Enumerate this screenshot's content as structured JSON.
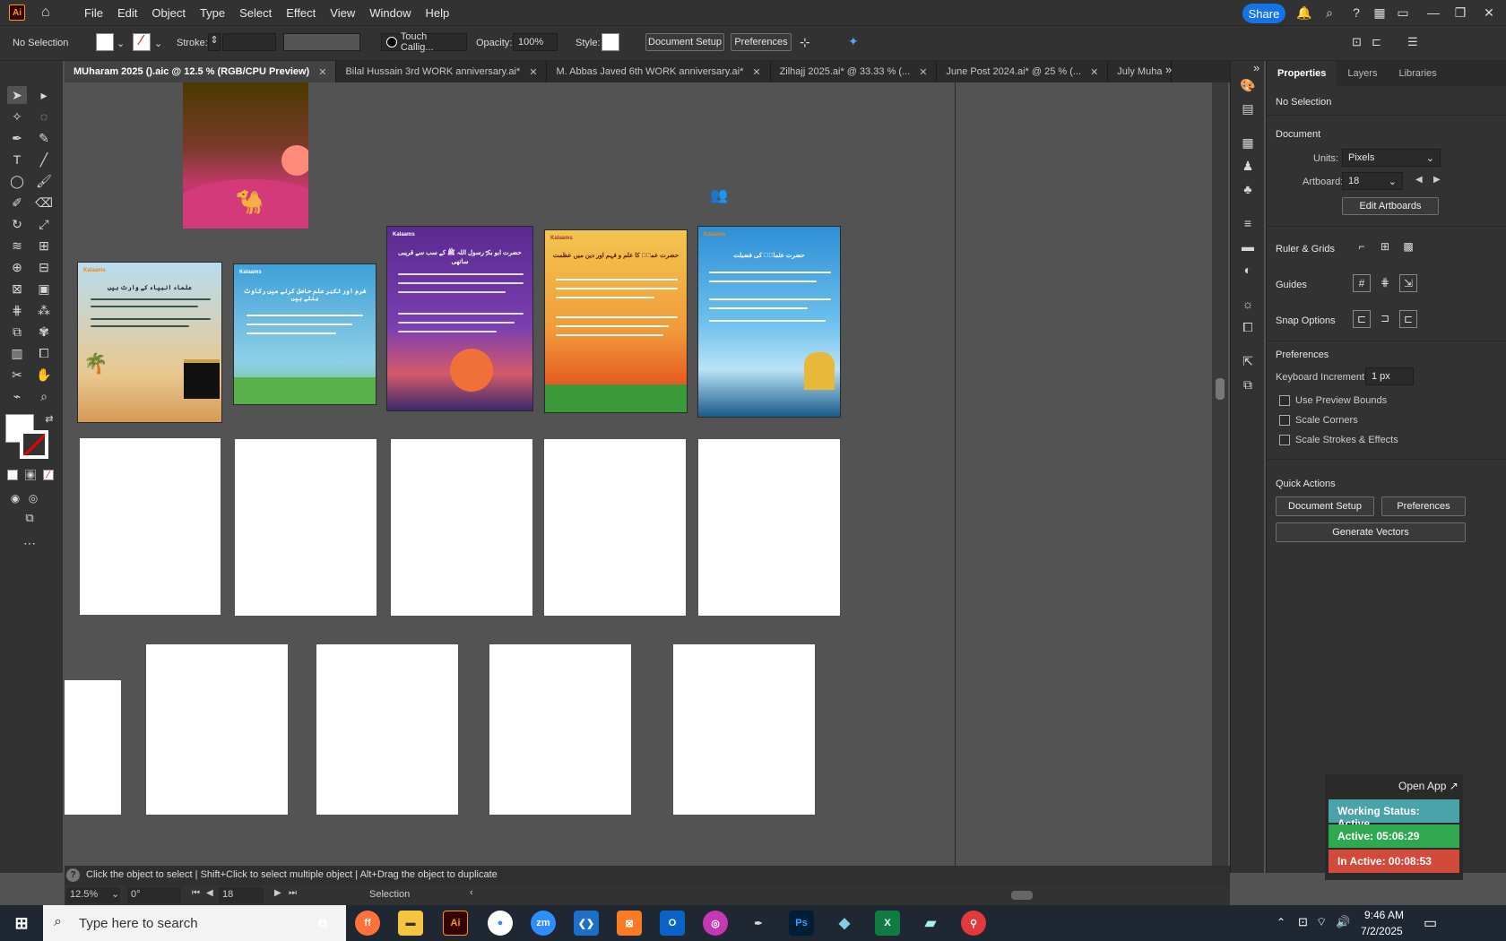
{
  "app": {
    "logo": "Ai",
    "menus": [
      "File",
      "Edit",
      "Object",
      "Type",
      "Select",
      "Effect",
      "View",
      "Window",
      "Help"
    ],
    "share": "Share"
  },
  "control": {
    "selection": "No Selection",
    "stroke_label": "Stroke:",
    "brush": "Touch Callig...",
    "opacity_label": "Opacity:",
    "opacity": "100%",
    "style_label": "Style:",
    "doc_setup": "Document Setup",
    "preferences": "Preferences"
  },
  "tabs": [
    {
      "label": "MUharam 2025 ().aic @ 12.5 % (RGB/CPU Preview)",
      "active": true
    },
    {
      "label": "Bilal Hussain  3rd  WORK anniversary.ai*"
    },
    {
      "label": "M. Abbas Javed  6th  WORK anniversary.ai*"
    },
    {
      "label": "Zilhajj 2025.ai* @ 33.33 % (..."
    },
    {
      "label": "June Post 2024.ai* @ 25 % (..."
    },
    {
      "label": "July Muha"
    }
  ],
  "posters": [
    {
      "brand": "Kalaams",
      "title": "علماء انبیاء کے وارث ہیں",
      "bg1": "#b8dcef",
      "bg2": "#d69a55"
    },
    {
      "brand": "Kalaams",
      "title": "شرم اور تکبر علم حاصل کرنے میں رکاوٹ بنتے ہیں",
      "bg1": "#3fa0d8",
      "bg2": "#6cc06a"
    },
    {
      "brand": "Kalaams",
      "title": "حضرت ابو بکرؓ رسول اللہ ﷺ کے سب سے قریبی ساتھی",
      "bg1": "#7a3fb0",
      "bg2": "#f08a3a"
    },
    {
      "brand": "Kalaams",
      "title": "حضرت عمرؓ کا علم و فہم اور دین میں عظمت",
      "bg1": "#f2c64f",
      "bg2": "#e65a22"
    },
    {
      "brand": "Kalaams",
      "title": "حضرت عثمانؓ کی فضیلت",
      "bg1": "#2e8fd6",
      "bg2": "#b9e3f7"
    }
  ],
  "properties": {
    "tabs": [
      "Properties",
      "Layers",
      "Libraries"
    ],
    "no_selection": "No Selection",
    "document": "Document",
    "units_label": "Units:",
    "units": "Pixels",
    "artboard_label": "Artboard:",
    "artboard": "18",
    "edit_artboards": "Edit Artboards",
    "ruler_grids": "Ruler & Grids",
    "guides": "Guides",
    "snap": "Snap Options",
    "prefs": "Preferences",
    "kbd_label": "Keyboard Increment:",
    "kbd": "1 px",
    "chk1": "Use Preview Bounds",
    "chk2": "Scale Corners",
    "chk3": "Scale Strokes & Effects",
    "quick": "Quick Actions",
    "qa_doc": "Document Setup",
    "qa_pref": "Preferences",
    "qa_vec": "Generate Vectors"
  },
  "status": {
    "hint": "Click the object to select  |  Shift+Click to select multiple object  |  Alt+Drag the object to duplicate",
    "zoom": "12.5%",
    "rotate": "0°",
    "artboard": "18",
    "mode": "Selection"
  },
  "work": {
    "open": "Open App ↗",
    "status": "Working Status: Active",
    "active": "Active: 05:06:29",
    "inactive": "In Active: 00:08:53",
    "c_status": "#4aa3a8",
    "c_active": "#2fa84f",
    "c_inactive": "#d24a3c"
  },
  "taskbar": {
    "search": "Type here to search",
    "time": "9:46 AM",
    "date": "7/2/2025"
  }
}
